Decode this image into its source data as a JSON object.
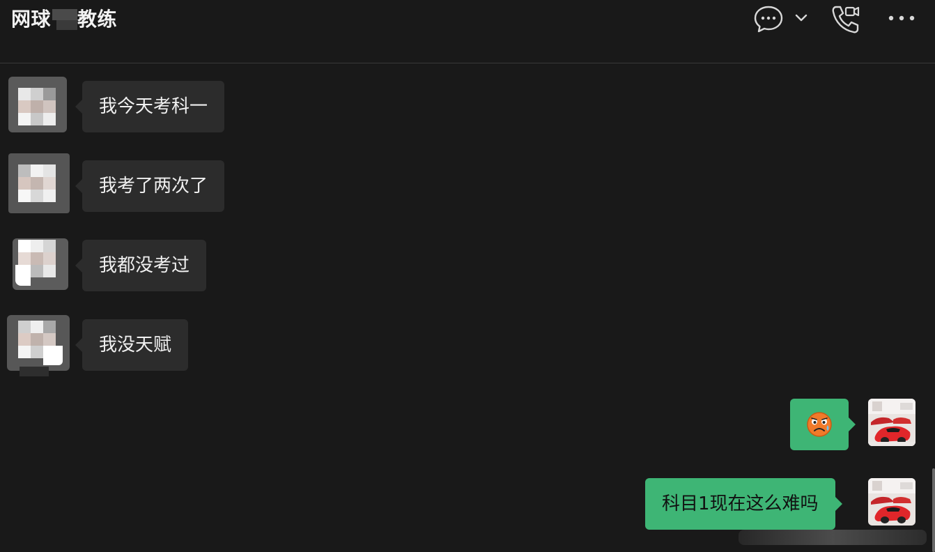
{
  "header": {
    "title_prefix": "网球",
    "title_suffix": "教练",
    "icons": [
      "chat-bubble-icon",
      "chevron-down-icon",
      "video-call-icon",
      "more-icon"
    ]
  },
  "messages": [
    {
      "direction": "incoming",
      "text": "我今天考科一"
    },
    {
      "direction": "incoming",
      "text": "我考了两次了"
    },
    {
      "direction": "incoming",
      "text": "我都没考过"
    },
    {
      "direction": "incoming",
      "text": "我没天赋"
    },
    {
      "direction": "outgoing",
      "emoji": "crying-face-sticker",
      "text": ""
    },
    {
      "direction": "outgoing",
      "text": "科目1现在这么难吗"
    }
  ],
  "colors": {
    "background": "#191919",
    "incoming_bubble": "#2c2c2c",
    "outgoing_bubble": "#3eb575",
    "title_text": "#f2f2f2"
  }
}
